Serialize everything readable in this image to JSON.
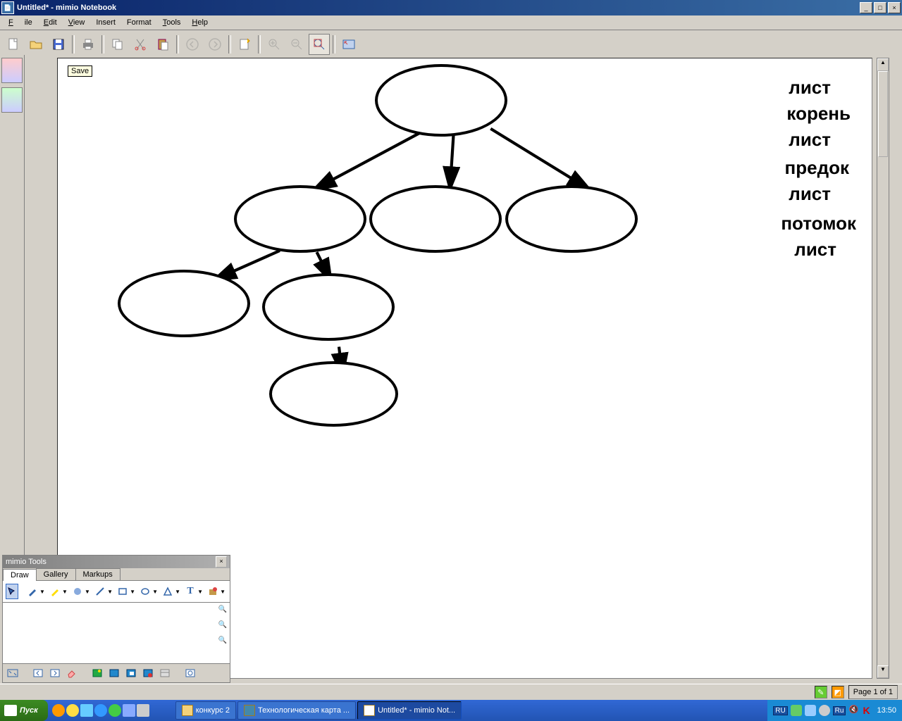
{
  "window": {
    "title": "Untitled* - mimio Notebook"
  },
  "menu": {
    "file": "File",
    "edit": "Edit",
    "view": "View",
    "insert": "Insert",
    "format": "Format",
    "tools": "Tools",
    "help": "Help"
  },
  "tooltip": {
    "save": "Save"
  },
  "labels": [
    "лист",
    "корень",
    "лист",
    "предок",
    "лист",
    "потомок",
    "лист"
  ],
  "status": {
    "page": "Page 1 of 1"
  },
  "palette": {
    "title": "mimio Tools",
    "tabs": {
      "draw": "Draw",
      "gallery": "Gallery",
      "markups": "Markups"
    }
  },
  "taskbar": {
    "start": "Пуск",
    "items": [
      {
        "label": "конкурс 2",
        "active": false,
        "icon": "folder"
      },
      {
        "label": "Технологическая карта ...",
        "active": false,
        "icon": "doc"
      },
      {
        "label": "Untitled* - mimio Not...",
        "active": true,
        "icon": "app"
      }
    ],
    "lang": "RU",
    "lang2": "Ru",
    "time": "13:50"
  }
}
